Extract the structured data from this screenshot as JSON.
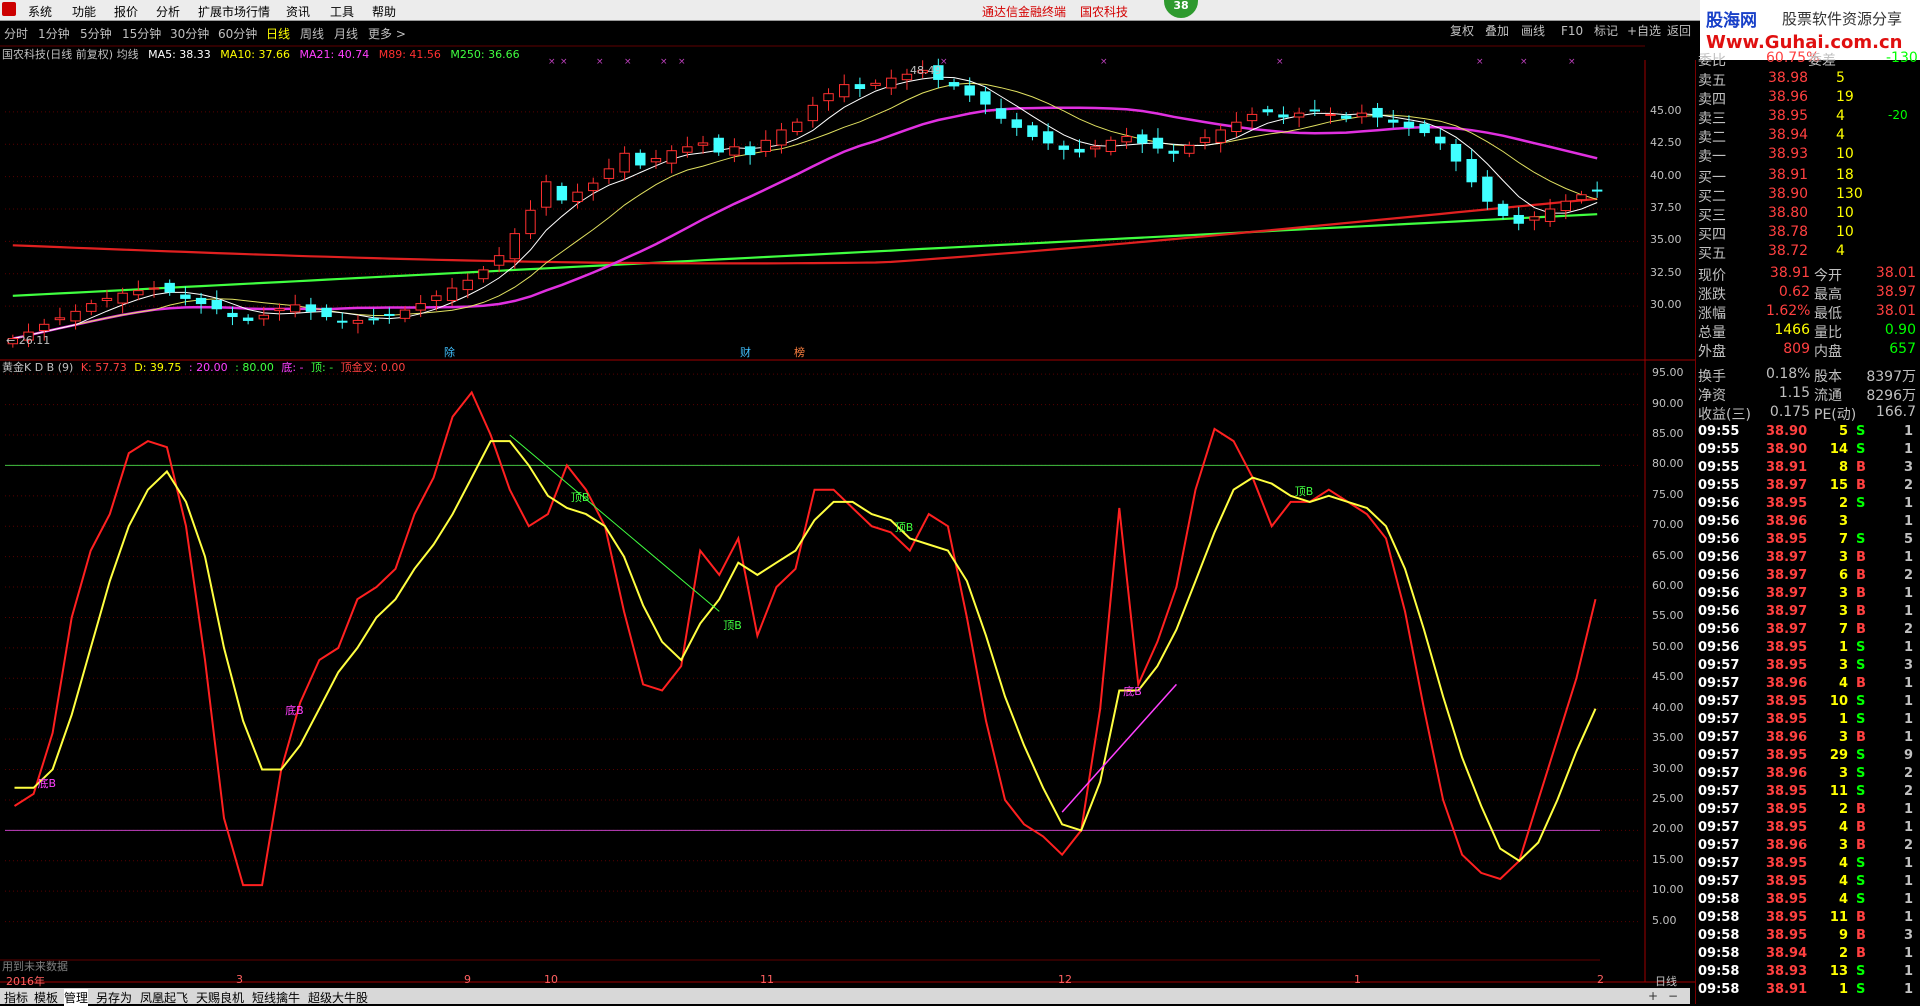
{
  "menu": {
    "items": [
      "系统",
      "功能",
      "报价",
      "分析",
      "扩展市场行情",
      "资讯",
      "工具",
      "帮助"
    ],
    "ad_links": [
      "通达信金融终端",
      "国农科技"
    ],
    "badge": "38"
  },
  "brand": {
    "line1": "股海网",
    "line2": "股票软件资源分享",
    "line3": "Www.Guhai.com.cn"
  },
  "periods": {
    "items": [
      "分时",
      "1分钟",
      "5分钟",
      "15分钟",
      "30分钟",
      "60分钟",
      "日线",
      "周线",
      "月线",
      "更多 >"
    ],
    "active_index": 6
  },
  "toolbar_right": [
    "复权",
    "叠加",
    "画线",
    "F10",
    "标记",
    "+自选",
    "返回"
  ],
  "chart_header": {
    "title": "国农科技(日线 前复权) 均线",
    "ma5": "MA5: 38.33",
    "ma10": "MA10: 37.66",
    "ma21": "MA21: 40.74",
    "ma89": "M89: 41.56",
    "ma250": "M250: 36.66"
  },
  "price_axis": [
    "45.00",
    "42.50",
    "40.00",
    "37.50",
    "35.00",
    "32.50",
    "30.00"
  ],
  "price_labels": {
    "high": "48.49",
    "low": "26.11"
  },
  "event_markers": [
    "除",
    "财",
    "榜"
  ],
  "indicator_header": {
    "name": "黄金K D B",
    "param": "(9)",
    "k": "K: 57.73",
    "d": "D: 39.75",
    "v20": ": 20.00",
    "v80": ": 80.00",
    "di": "底: -",
    "ding": "顶: -",
    "sjx": "顶金叉: 0.00"
  },
  "indicator_axis": [
    "95.00",
    "90.00",
    "85.00",
    "80.00",
    "75.00",
    "70.00",
    "65.00",
    "60.00",
    "55.00",
    "50.00",
    "45.00",
    "40.00",
    "35.00",
    "30.00",
    "25.00",
    "20.00",
    "15.00",
    "10.00",
    "5.00"
  ],
  "indicator_signals": [
    {
      "text": "底B",
      "color": "#ff40ff"
    },
    {
      "text": "底B",
      "color": "#ff40ff"
    },
    {
      "text": "顶B",
      "color": "#40ff40"
    },
    {
      "text": "顶B",
      "color": "#40ff40"
    },
    {
      "text": "顶B",
      "color": "#40ff40"
    },
    {
      "text": "底B",
      "color": "#ff40ff"
    },
    {
      "text": "顶B",
      "color": "#40ff40"
    }
  ],
  "future_note": "用到未来数据",
  "time_axis": [
    "2016年",
    "3",
    "9",
    "10",
    "11",
    "12",
    "1",
    "2"
  ],
  "time_axis_right": "日线",
  "bottom_tabs": [
    "指标",
    "模板",
    "管理",
    "另存为",
    "凤凰起飞",
    "天赐良机",
    "短线擒牛",
    "超级大牛股"
  ],
  "bottom_active": 2,
  "quote": {
    "weibi_label": "委比",
    "weibi_value": "60.75%",
    "weicha_label": "委差",
    "weicha_value": "-130",
    "asks": [
      {
        "label": "卖五",
        "price": "38.98",
        "vol": "5",
        "chg": ""
      },
      {
        "label": "卖四",
        "price": "38.96",
        "vol": "19",
        "chg": ""
      },
      {
        "label": "卖三",
        "price": "38.95",
        "vol": "4",
        "chg": "-20"
      },
      {
        "label": "卖二",
        "price": "38.94",
        "vol": "4",
        "chg": ""
      },
      {
        "label": "卖一",
        "price": "38.93",
        "vol": "10",
        "chg": ""
      }
    ],
    "bids": [
      {
        "label": "买一",
        "price": "38.91",
        "vol": "18"
      },
      {
        "label": "买二",
        "price": "38.90",
        "vol": "130"
      },
      {
        "label": "买三",
        "price": "38.80",
        "vol": "10"
      },
      {
        "label": "买四",
        "price": "38.78",
        "vol": "10"
      },
      {
        "label": "买五",
        "price": "38.72",
        "vol": "4"
      }
    ],
    "stats": [
      {
        "l1": "现价",
        "v1": "38.91",
        "l2": "今开",
        "v2": "38.01",
        "c1": "#ff4040",
        "c2": "#ff4040"
      },
      {
        "l1": "涨跌",
        "v1": "0.62",
        "l2": "最高",
        "v2": "38.97",
        "c1": "#ff4040",
        "c2": "#ff4040"
      },
      {
        "l1": "涨幅",
        "v1": "1.62%",
        "l2": "最低",
        "v2": "38.01",
        "c1": "#ff4040",
        "c2": "#ff4040"
      },
      {
        "l1": "总量",
        "v1": "1466",
        "l2": "量比",
        "v2": "0.90",
        "c1": "#ffff00",
        "c2": "#00ff00"
      },
      {
        "l1": "外盘",
        "v1": "809",
        "l2": "内盘",
        "v2": "657",
        "c1": "#ff4040",
        "c2": "#00ff00"
      },
      {
        "l1": "换手",
        "v1": "0.18%",
        "l2": "股本",
        "v2": "8397万",
        "c1": "#c0c0c0",
        "c2": "#c0c0c0"
      },
      {
        "l1": "净资",
        "v1": "1.15",
        "l2": "流通",
        "v2": "8296万",
        "c1": "#c0c0c0",
        "c2": "#c0c0c0"
      },
      {
        "l1": "收益(三)",
        "v1": "0.175",
        "l2": "PE(动)",
        "v2": "166.7",
        "c1": "#c0c0c0",
        "c2": "#c0c0c0"
      }
    ],
    "ticks": [
      {
        "t": "09:55",
        "p": "38.90",
        "v": "5",
        "d": "S",
        "n": "1"
      },
      {
        "t": "09:55",
        "p": "38.90",
        "v": "14",
        "d": "S",
        "n": "1"
      },
      {
        "t": "09:55",
        "p": "38.91",
        "v": "8",
        "d": "B",
        "n": "3"
      },
      {
        "t": "09:55",
        "p": "38.97",
        "v": "15",
        "d": "B",
        "n": "2"
      },
      {
        "t": "09:56",
        "p": "38.95",
        "v": "2",
        "d": "S",
        "n": "1"
      },
      {
        "t": "09:56",
        "p": "38.96",
        "v": "3",
        "d": "",
        "n": "1"
      },
      {
        "t": "09:56",
        "p": "38.95",
        "v": "7",
        "d": "S",
        "n": "5"
      },
      {
        "t": "09:56",
        "p": "38.97",
        "v": "3",
        "d": "B",
        "n": "1"
      },
      {
        "t": "09:56",
        "p": "38.97",
        "v": "6",
        "d": "B",
        "n": "2"
      },
      {
        "t": "09:56",
        "p": "38.97",
        "v": "3",
        "d": "B",
        "n": "1"
      },
      {
        "t": "09:56",
        "p": "38.97",
        "v": "3",
        "d": "B",
        "n": "1"
      },
      {
        "t": "09:56",
        "p": "38.97",
        "v": "7",
        "d": "B",
        "n": "2"
      },
      {
        "t": "09:56",
        "p": "38.95",
        "v": "1",
        "d": "S",
        "n": "1"
      },
      {
        "t": "09:57",
        "p": "38.95",
        "v": "3",
        "d": "S",
        "n": "3"
      },
      {
        "t": "09:57",
        "p": "38.96",
        "v": "4",
        "d": "B",
        "n": "1"
      },
      {
        "t": "09:57",
        "p": "38.95",
        "v": "10",
        "d": "S",
        "n": "1"
      },
      {
        "t": "09:57",
        "p": "38.95",
        "v": "1",
        "d": "S",
        "n": "1"
      },
      {
        "t": "09:57",
        "p": "38.96",
        "v": "3",
        "d": "B",
        "n": "1"
      },
      {
        "t": "09:57",
        "p": "38.95",
        "v": "29",
        "d": "S",
        "n": "9"
      },
      {
        "t": "09:57",
        "p": "38.96",
        "v": "3",
        "d": "S",
        "n": "2"
      },
      {
        "t": "09:57",
        "p": "38.95",
        "v": "11",
        "d": "S",
        "n": "2"
      },
      {
        "t": "09:57",
        "p": "38.95",
        "v": "2",
        "d": "B",
        "n": "1"
      },
      {
        "t": "09:57",
        "p": "38.95",
        "v": "4",
        "d": "B",
        "n": "1"
      },
      {
        "t": "09:57",
        "p": "38.96",
        "v": "3",
        "d": "B",
        "n": "2"
      },
      {
        "t": "09:57",
        "p": "38.95",
        "v": "4",
        "d": "S",
        "n": "1"
      },
      {
        "t": "09:57",
        "p": "38.95",
        "v": "4",
        "d": "S",
        "n": "1"
      },
      {
        "t": "09:58",
        "p": "38.95",
        "v": "4",
        "d": "S",
        "n": "1"
      },
      {
        "t": "09:58",
        "p": "38.95",
        "v": "11",
        "d": "B",
        "n": "1"
      },
      {
        "t": "09:58",
        "p": "38.95",
        "v": "9",
        "d": "B",
        "n": "3"
      },
      {
        "t": "09:58",
        "p": "38.94",
        "v": "2",
        "d": "B",
        "n": "1"
      },
      {
        "t": "09:58",
        "p": "38.93",
        "v": "13",
        "d": "S",
        "n": "1"
      },
      {
        "t": "09:58",
        "p": "38.91",
        "v": "1",
        "d": "S",
        "n": "1"
      }
    ]
  },
  "chart_data": [
    {
      "type": "candlestick",
      "title": "国农科技(日线 前复权)",
      "ylim": [
        26,
        49
      ],
      "closes": [
        27.5,
        28.0,
        28.6,
        29.1,
        29.6,
        30.2,
        30.6,
        31.0,
        31.2,
        31.4,
        31.1,
        30.6,
        30.2,
        29.8,
        29.2,
        28.9,
        29.3,
        29.8,
        30.1,
        29.6,
        29.2,
        28.8,
        28.9,
        29.0,
        29.3,
        29.7,
        30.2,
        30.8,
        31.4,
        32.0,
        32.8,
        33.9,
        35.6,
        37.4,
        39.6,
        38.2,
        38.8,
        39.5,
        40.6,
        41.8,
        40.9,
        41.4,
        42.0,
        42.3,
        42.6,
        41.9,
        42.3,
        41.7,
        42.8,
        43.6,
        44.2,
        45.5,
        46.4,
        47.1,
        46.8,
        47.2,
        47.6,
        47.9,
        48.2,
        47.5,
        47.0,
        46.3,
        45.6,
        44.5,
        43.8,
        43.1,
        42.6,
        42.1,
        41.9,
        42.3,
        42.8,
        43.1,
        42.6,
        42.2,
        41.8,
        42.4,
        43.0,
        43.6,
        44.2,
        44.8,
        45.0,
        44.6,
        44.9,
        45.1,
        44.8,
        44.5,
        44.9,
        44.6,
        44.2,
        43.8,
        43.4,
        42.6,
        41.2,
        39.6,
        38.1,
        37.0,
        36.4,
        36.9,
        37.5,
        38.1,
        38.6,
        38.9
      ]
    },
    {
      "type": "line",
      "title": "黄金K D B",
      "ylim": [
        0,
        97
      ],
      "series": [
        {
          "name": "K",
          "values": [
            24,
            26,
            36,
            55,
            66,
            72,
            82,
            84,
            83,
            70,
            48,
            22,
            11,
            11,
            30,
            41,
            48,
            50,
            58,
            60,
            63,
            72,
            78,
            88,
            92,
            85,
            76,
            70,
            72,
            80,
            76,
            70,
            56,
            44,
            43,
            47,
            66,
            62,
            68,
            52,
            60,
            63,
            76,
            76,
            73,
            70,
            69,
            66,
            72,
            70,
            55,
            38,
            25,
            21,
            19,
            16,
            20,
            40,
            73,
            44,
            51,
            60,
            76,
            86,
            84,
            78,
            70,
            74,
            74,
            76,
            74,
            72,
            68,
            56,
            40,
            25,
            16,
            13,
            12,
            15,
            25,
            35,
            45,
            58
          ]
        },
        {
          "name": "D",
          "values": [
            27,
            27,
            30,
            39,
            50,
            61,
            70,
            76,
            79,
            74,
            65,
            50,
            38,
            30,
            30,
            34,
            40,
            46,
            50,
            55,
            58,
            63,
            67,
            72,
            78,
            84,
            84,
            80,
            75,
            73,
            72,
            70,
            65,
            57,
            51,
            48,
            54,
            58,
            64,
            62,
            64,
            66,
            71,
            74,
            74,
            72,
            71,
            68,
            67,
            66,
            61,
            52,
            42,
            34,
            27,
            21,
            20,
            28,
            43,
            43,
            47,
            53,
            61,
            69,
            76,
            78,
            77,
            75,
            74,
            75,
            74,
            73,
            70,
            63,
            53,
            42,
            32,
            24,
            17,
            15,
            18,
            25,
            33,
            40
          ]
        }
      ]
    }
  ]
}
